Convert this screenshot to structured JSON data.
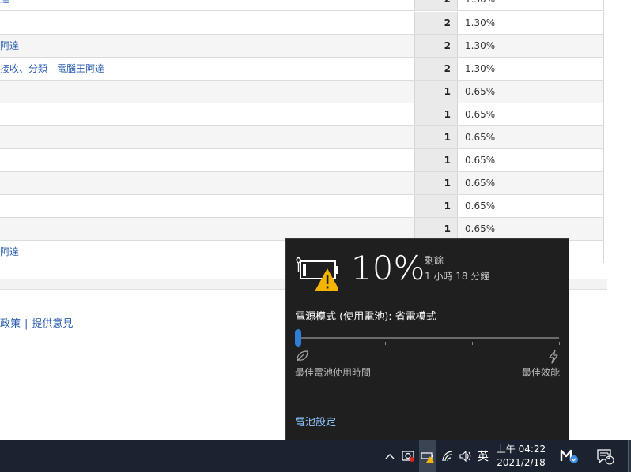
{
  "table": {
    "rows": [
      {
        "page": "達",
        "count": "2",
        "percent": "1.30%",
        "style": "plain"
      },
      {
        "page": "",
        "count": "2",
        "percent": "1.30%",
        "style": "plain"
      },
      {
        "page": "阿達",
        "count": "2",
        "percent": "1.30%",
        "style": "alt"
      },
      {
        "page": "接收、分類 - 電腦王阿達",
        "count": "2",
        "percent": "1.30%",
        "style": "plain"
      },
      {
        "page": "",
        "count": "1",
        "percent": "0.65%",
        "style": "alt"
      },
      {
        "page": "",
        "count": "1",
        "percent": "0.65%",
        "style": "plain"
      },
      {
        "page": "",
        "count": "1",
        "percent": "0.65%",
        "style": "alt"
      },
      {
        "page": "",
        "count": "1",
        "percent": "0.65%",
        "style": "plain"
      },
      {
        "page": "",
        "count": "1",
        "percent": "0.65%",
        "style": "alt"
      },
      {
        "page": "",
        "count": "1",
        "percent": "0.65%",
        "style": "plain"
      },
      {
        "page": "",
        "count": "1",
        "percent": "0.65%",
        "style": "alt"
      },
      {
        "page": "阿達",
        "count": "",
        "percent": "",
        "style": "plain"
      }
    ]
  },
  "footer": {
    "privacy_link": "政策",
    "separator": "|",
    "feedback_link": "提供意見"
  },
  "battery_flyout": {
    "percent": "10%",
    "remaining_label": "剩餘",
    "remaining_time": "1 小時 18 分鐘",
    "power_mode_title": "電源模式 (使用電池): 省電模式",
    "slider_level": 0,
    "label_best_battery": "最佳電池使用時間",
    "label_best_performance": "最佳效能",
    "settings_link": "電池設定",
    "icons": [
      "battery-warning-icon",
      "leaf-icon",
      "lightning-bolt-icon"
    ]
  },
  "taskbar": {
    "ime": "英",
    "time": "上午 04:22",
    "date": "2021/2/18",
    "notification_count": "1",
    "icons": [
      "chevron-up-icon",
      "camera-icon",
      "battery-icon",
      "wifi-icon",
      "volume-icon",
      "app-icon",
      "notification-icon"
    ]
  },
  "colors": {
    "link": "#2a5db0",
    "flyout_bg": "#1f1f1f",
    "accent": "#2f7fd6",
    "taskbar_bg": "#1c2330",
    "warning": "#f5b400"
  }
}
